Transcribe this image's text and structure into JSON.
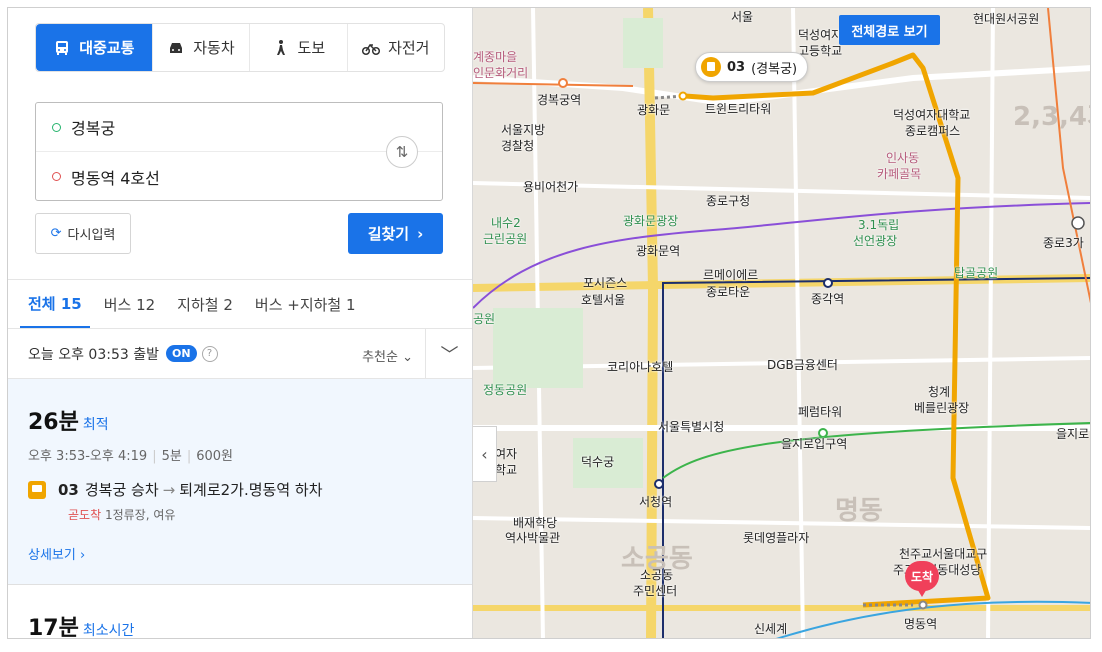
{
  "modes": [
    {
      "label": "대중교통",
      "icon": "bus-icon",
      "active": true
    },
    {
      "label": "자동차",
      "icon": "car-icon",
      "active": false
    },
    {
      "label": "도보",
      "icon": "walk-icon",
      "active": false
    },
    {
      "label": "자전거",
      "icon": "bike-icon",
      "active": false
    }
  ],
  "route": {
    "origin": "경복궁",
    "destination": "명동역 4호선"
  },
  "buttons": {
    "reset": "다시입력",
    "find": "길찾기"
  },
  "tabs": [
    {
      "label": "전체 15",
      "active": true
    },
    {
      "label": "버스 12",
      "active": false
    },
    {
      "label": "지하철 2",
      "active": false
    },
    {
      "label": "버스 +지하철 1",
      "active": false
    }
  ],
  "depart": {
    "text": "오늘 오후 03:53 출발",
    "toggle": "ON",
    "sort": "추천순"
  },
  "results": [
    {
      "duration": "26분",
      "tag": "최적",
      "time_range": "오후 3:53-오후 4:19",
      "walk": "5분",
      "fare": "600원",
      "bus_no": "03",
      "board": "경복궁 승차",
      "alight": "퇴계로2가.명동역 하차",
      "status": "곧도착",
      "status_detail": "1정류장, 여유",
      "detail_link": "상세보기"
    },
    {
      "duration": "17분",
      "tag": "최소시간"
    }
  ],
  "map": {
    "full_route_button": "전체경로 보기",
    "bus_callout": "03",
    "bus_callout_sub": "(경복궁)",
    "arrive_label": "도착",
    "labels": {
      "l1": "경복궁역",
      "l2": "광화문",
      "l3": "트윈트리타워",
      "l4": "서울지방",
      "l5": "경찰청",
      "l6": "용비어천가",
      "l7": "광화문광장",
      "l8": "광화문역",
      "l9": "종로구청",
      "l10": "내수2",
      "l11": "근린공원",
      "l12": "포시즌스",
      "l13": "호텔서울",
      "l14": "르메이에르",
      "l15": "종로타운",
      "l16": "종각역",
      "l17": "코리아나호텔",
      "l18": "DGB금융센터",
      "l19": "정동공원",
      "l20": "서울특별시청",
      "l21": "페럼타워",
      "l22": "을지로입구역",
      "l23": "덕수궁",
      "l24": "서청역",
      "l25": "배재학당",
      "l26": "역사박물관",
      "l27": "롯데영플라자",
      "l28": "소공동",
      "l29": "주민센터",
      "l30": "신세계",
      "l31": "명동역",
      "l32": "인사동",
      "l33": "카페골목",
      "l34": "3.1독립",
      "l35": "선언광장",
      "l36": "덕성여자대학교",
      "l37": "종로캠퍼스",
      "l38": "덕성여자",
      "l39": "고등학교",
      "l40": "현대원서공원",
      "l41": "종로3가",
      "l42": "청계",
      "l43": "베를린광장",
      "l44": "천주교서울대교구",
      "l45": "주교좌명동대성당",
      "l46": "을지로",
      "l47": "여자",
      "l48": "학교",
      "l49": "계종마을",
      "l50": "인문화거리",
      "l51": "서울",
      "l52": "탑골공원",
      "l53": "명동",
      "l54": "소공동",
      "l55": "2,3,4가",
      "l56": "공원"
    }
  }
}
